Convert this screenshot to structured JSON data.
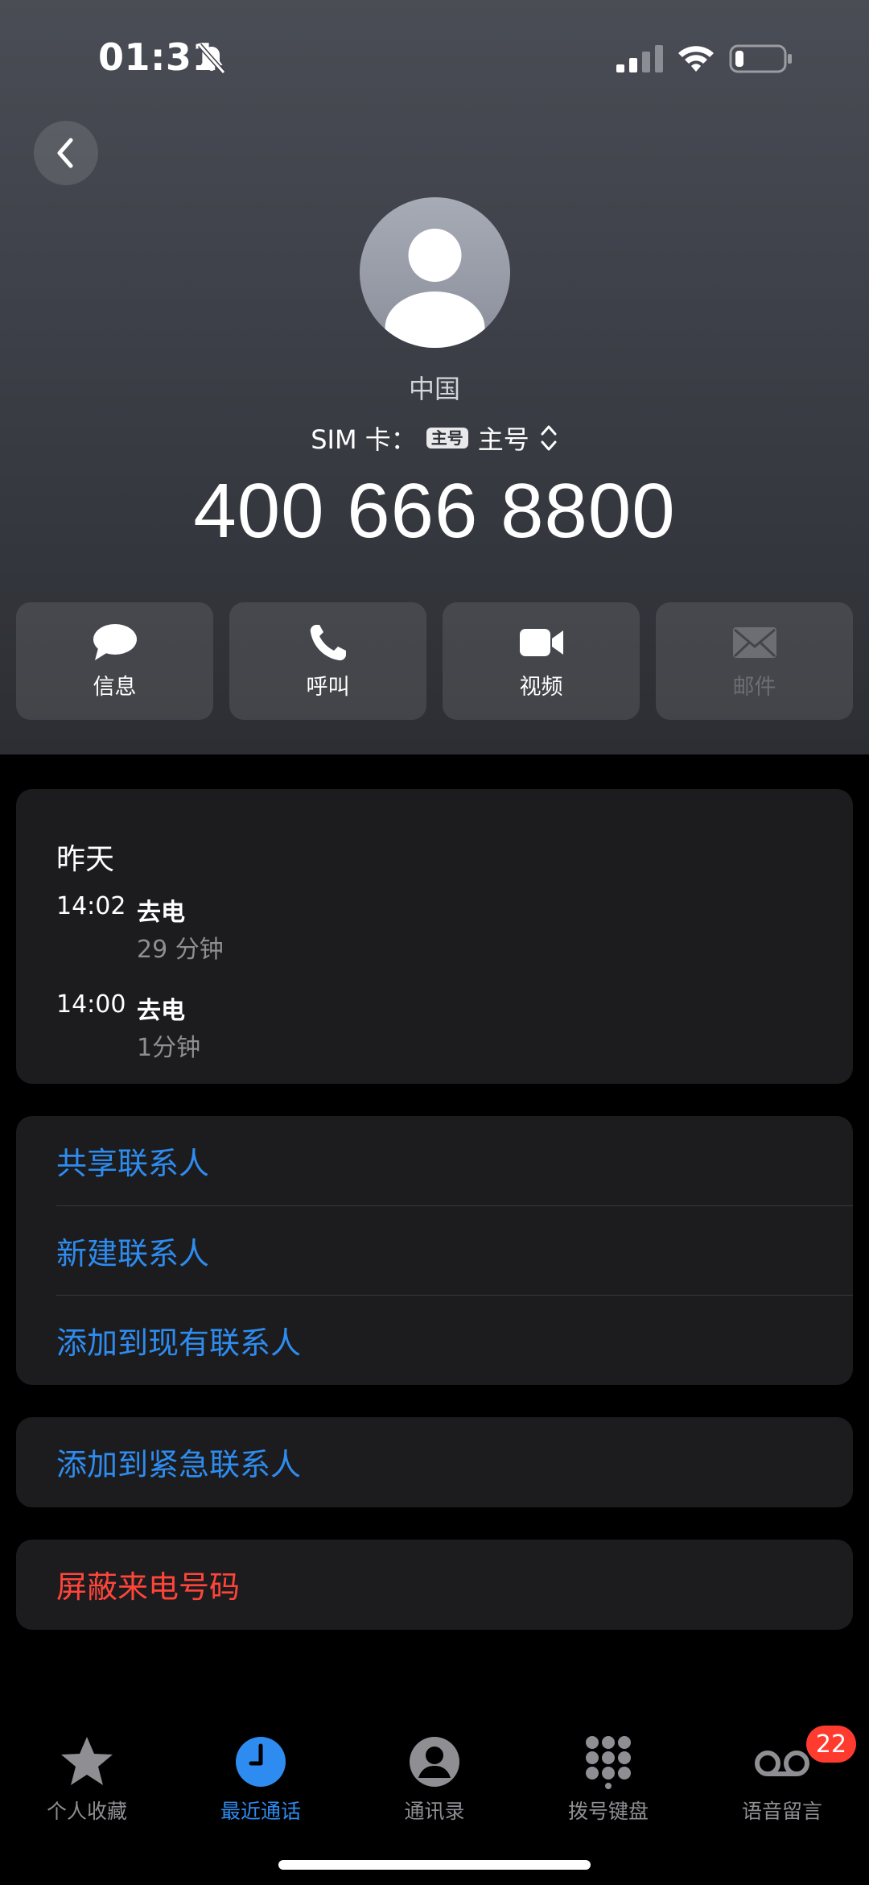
{
  "status_bar": {
    "time": "01:31"
  },
  "header": {
    "contact_name": "中国",
    "sim_label": "SIM 卡：",
    "sim_badge": "主号",
    "sim_value": "主号",
    "phone_number": "400 666 8800"
  },
  "actions": [
    {
      "label": "信息",
      "icon": "message-icon"
    },
    {
      "label": "呼叫",
      "icon": "phone-icon"
    },
    {
      "label": "视频",
      "icon": "video-icon"
    },
    {
      "label": "邮件",
      "icon": "mail-icon",
      "disabled": true
    }
  ],
  "history": {
    "day": "昨天",
    "calls": [
      {
        "time": "14:02",
        "type": "去电",
        "duration": "29 分钟"
      },
      {
        "time": "14:00",
        "type": "去电",
        "duration": "1分钟"
      }
    ]
  },
  "menu": {
    "share_contact": "共享联系人",
    "new_contact": "新建联系人",
    "add_existing": "添加到现有联系人",
    "add_emergency": "添加到紧急联系人",
    "block_caller": "屏蔽来电号码"
  },
  "tabs": [
    {
      "label": "个人收藏",
      "icon": "star-icon"
    },
    {
      "label": "最近通话",
      "icon": "clock-icon",
      "active": true
    },
    {
      "label": "通讯录",
      "icon": "contact-icon"
    },
    {
      "label": "拨号键盘",
      "icon": "keypad-icon"
    },
    {
      "label": "语音留言",
      "icon": "voicemail-icon",
      "badge": "22"
    }
  ],
  "colors": {
    "accent": "#2e8cf0",
    "danger": "#ff453a",
    "badge": "#ff3b30"
  }
}
